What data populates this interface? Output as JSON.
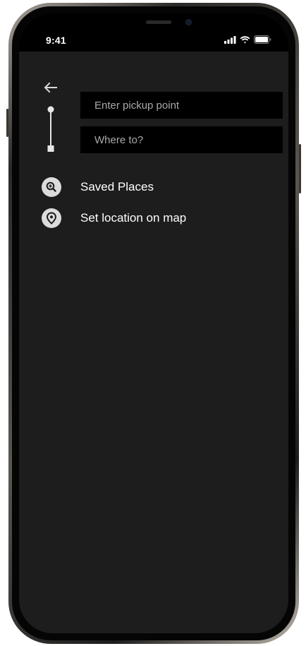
{
  "status_bar": {
    "time": "9:41"
  },
  "navigation": {
    "back_icon": "arrow-left-icon"
  },
  "search": {
    "pickup_placeholder": "Enter pickup point",
    "pickup_value": "",
    "destination_placeholder": "Where to?",
    "destination_value": ""
  },
  "options": {
    "saved_places": {
      "label": "Saved Places",
      "icon": "search-zoom-icon"
    },
    "set_location": {
      "label": "Set location on map",
      "icon": "location-pin-icon"
    }
  },
  "colors": {
    "screen_background": "#1d1d1d",
    "status_bar_background": "#000000",
    "input_background": "#000000",
    "icon_circle": "#dcdcdc",
    "text_primary": "#ffffff",
    "placeholder_text": "#a9a9a9"
  }
}
